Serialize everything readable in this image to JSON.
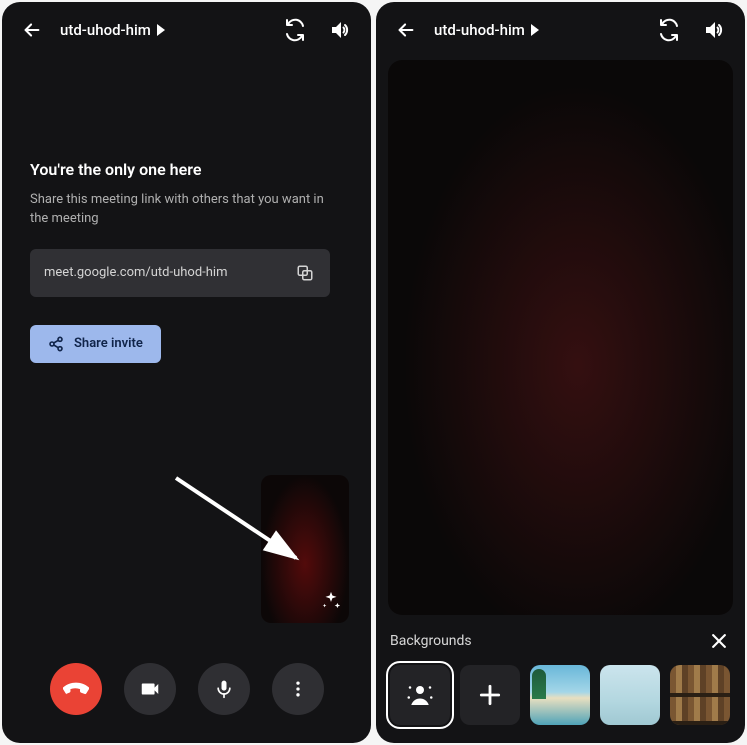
{
  "left": {
    "header": {
      "meeting_code": "utd-uhod-him"
    },
    "content": {
      "only_one_title": "You're the only one here",
      "share_desc": "Share this meeting link with others that you want in the meeting",
      "meeting_link": "meet.google.com/utd-uhod-him",
      "share_invite_label": "Share invite"
    }
  },
  "right": {
    "header": {
      "meeting_code": "utd-uhod-him"
    },
    "backgrounds": {
      "panel_title": "Backgrounds",
      "options": [
        {
          "id": "none",
          "label": "No effect",
          "selected": true
        },
        {
          "id": "add",
          "label": "Add image"
        },
        {
          "id": "beach",
          "label": "Beach"
        },
        {
          "id": "blur",
          "label": "Light blur"
        },
        {
          "id": "books",
          "label": "Bookshelf"
        }
      ]
    }
  }
}
